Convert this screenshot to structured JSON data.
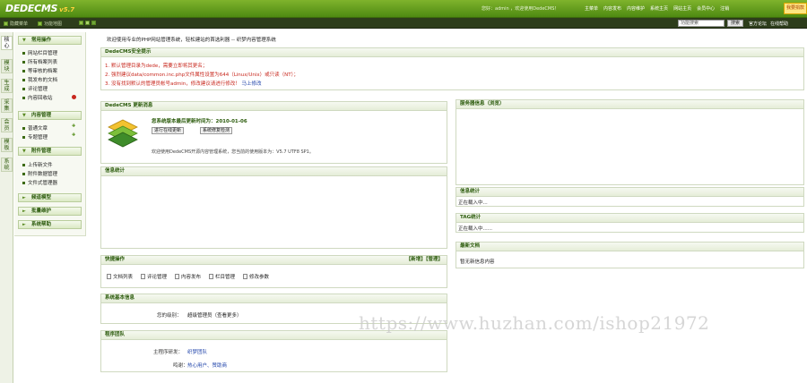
{
  "header": {
    "logo_name": "DEDECMS",
    "logo_version": "v5.7",
    "top_info": "您好：admin ，欢迎使用DedeCMS！",
    "nav": [
      "主菜单",
      "内容发布",
      "内容维护",
      "系统主页",
      "网站主页",
      "会员中心",
      "注销"
    ],
    "donate": "我要捐款"
  },
  "subbar": {
    "hide_menu": "隐藏菜单",
    "function_map": "功能地图",
    "search_placeholder": "功能搜索",
    "search_button": "搜索",
    "links": [
      "官方论坛",
      "在线帮助"
    ]
  },
  "vtabs": [
    "核心",
    "模块",
    "生成",
    "采集",
    "会员",
    "模板",
    "系统"
  ],
  "menu": {
    "sections": [
      {
        "title": "常用操作",
        "items": [
          "网站栏目管理",
          "所有档案列表",
          "等审核的档案",
          "我发布的文档",
          "评论管理",
          "内容回收站"
        ]
      },
      {
        "title": "内容管理",
        "items": [
          "普通文章",
          "专题管理"
        ]
      },
      {
        "title": "附件管理",
        "items": [
          "上传新文件",
          "附件数据管理",
          "文件式管理器"
        ]
      },
      {
        "title": "频道模型"
      },
      {
        "title": "批量维护"
      },
      {
        "title": "系统帮助"
      }
    ]
  },
  "main": {
    "welcome": "欢迎使用专业的PHP网站管理系统，轻松建站的首选利器 -- 织梦内容管理系统",
    "security": {
      "title": "DedeCMS安全提示",
      "lines": [
        "1. 默认管理目录为dede，需要立即将其更名；",
        "2. 强烈建议data/common.inc.php文件属性设置为644（Linux/Unix）或只读（NT）；",
        "3. 没有找到默认的管理员帐号admin，修改建议请进行修改！"
      ],
      "fix_link": "马上修改"
    },
    "update": {
      "title": "DedeCMS 更新消息",
      "version_text": "您系统版本最后更新时间为：2010-01-06",
      "check_button": "进行在线更新",
      "system_check": "系统修复检测",
      "note": "欢迎使用DedeCMS开源内容管理系统，您当前的使用版本为：V5.7 UTF8 SP1。"
    },
    "info": {
      "title": "信息统计"
    },
    "quick": {
      "title": "快捷操作",
      "right": "【新增】【管理】",
      "items": [
        "文档列表",
        "评论管理",
        "内容发布",
        "栏目管理",
        "修改参数"
      ]
    },
    "sysinfo": {
      "title": "系统基本信息",
      "label": "您的级别：",
      "value": "超级管理员（查看更多）"
    },
    "team": {
      "title": "程序团队",
      "lead_label": "主程序研发：",
      "lead_value": "织梦团队",
      "thanks_label": "鸣谢：",
      "thanks_value": "热心用户、赞助商"
    }
  },
  "right": {
    "server_title": "服务器信息（浏览）",
    "stats_title": "信息统计",
    "stats_text": "正在载入中...",
    "tags_title": "TAG统计",
    "tags_text": "正在载入中......",
    "latest_title": "最新文档",
    "latest_text": "暂无新信息内容"
  },
  "watermark": "https://www.huzhan.com/ishop21972"
}
